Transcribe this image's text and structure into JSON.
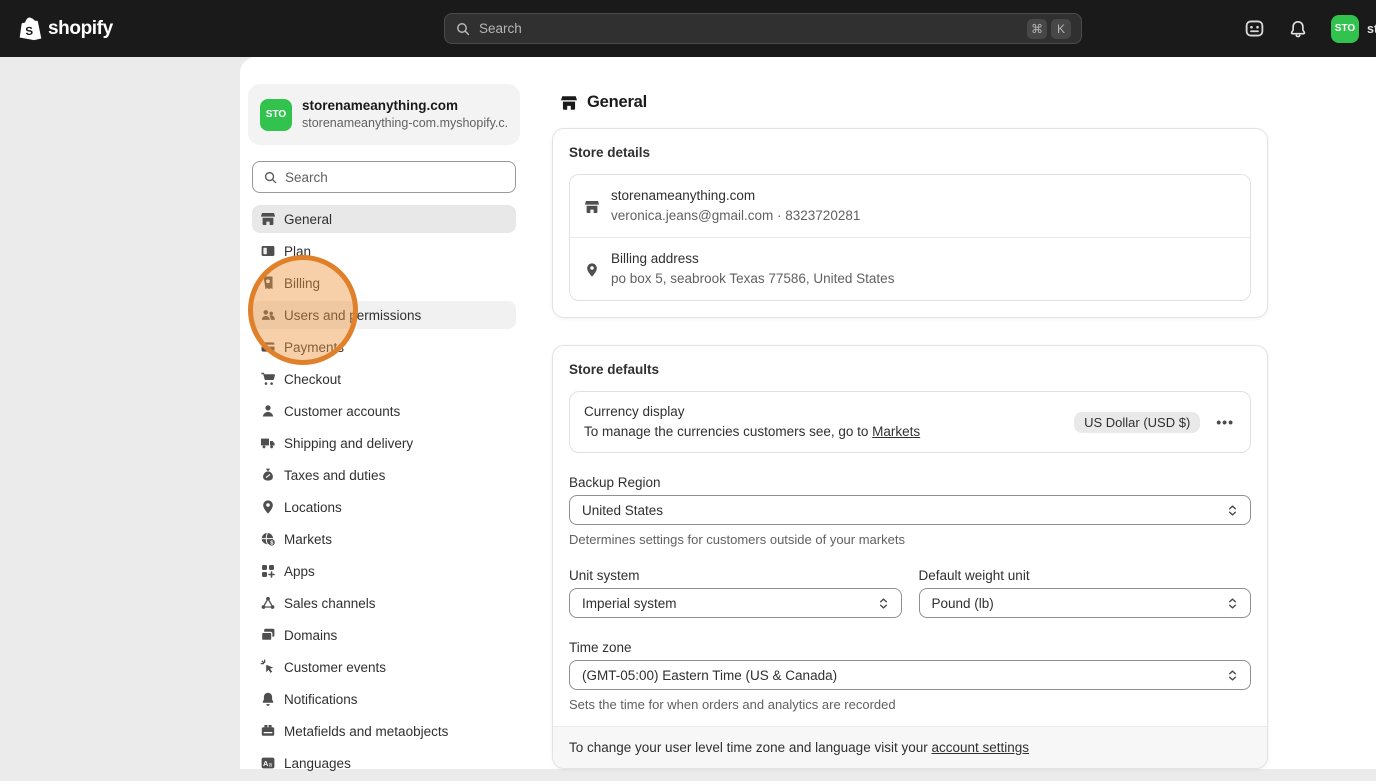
{
  "colors": {
    "topbar_bg": "#1a1a1a",
    "avatar_green": "#32c24e",
    "highlight_orange_border": "#e0802a",
    "highlight_orange_fill": "rgba(238,148,62,0.45)",
    "backdrop": "#ebebeb",
    "text_primary": "#303030",
    "text_secondary": "#616161"
  },
  "topbar": {
    "logo_text": "shopify",
    "search_placeholder": "Search",
    "kbd_cmd": "⌘",
    "kbd_k": "K",
    "avatar_initials": "STO",
    "store_name_truncated": "st"
  },
  "sidebar": {
    "store": {
      "initials": "STO",
      "name": "storenameanything.com",
      "domain": "storenameanything-com.myshopify.c..."
    },
    "search_placeholder": "Search",
    "items": [
      {
        "label": "General",
        "icon": "storefront",
        "state": "active"
      },
      {
        "label": "Plan",
        "icon": "plan",
        "state": ""
      },
      {
        "label": "Billing",
        "icon": "billing",
        "state": ""
      },
      {
        "label": "Users and permissions",
        "icon": "users",
        "state": "hover"
      },
      {
        "label": "Payments",
        "icon": "payments",
        "state": ""
      },
      {
        "label": "Checkout",
        "icon": "cart",
        "state": ""
      },
      {
        "label": "Customer accounts",
        "icon": "person",
        "state": ""
      },
      {
        "label": "Shipping and delivery",
        "icon": "truck",
        "state": ""
      },
      {
        "label": "Taxes and duties",
        "icon": "moneybag",
        "state": ""
      },
      {
        "label": "Locations",
        "icon": "pin",
        "state": ""
      },
      {
        "label": "Markets",
        "icon": "globe",
        "state": ""
      },
      {
        "label": "Apps",
        "icon": "apps",
        "state": ""
      },
      {
        "label": "Sales channels",
        "icon": "nodes",
        "state": ""
      },
      {
        "label": "Domains",
        "icon": "domains",
        "state": ""
      },
      {
        "label": "Customer events",
        "icon": "cursor",
        "state": ""
      },
      {
        "label": "Notifications",
        "icon": "bell",
        "state": ""
      },
      {
        "label": "Metafields and metaobjects",
        "icon": "metafields",
        "state": ""
      },
      {
        "label": "Languages",
        "icon": "languages",
        "state": ""
      }
    ]
  },
  "main": {
    "title": "General",
    "store_details": {
      "heading": "Store details",
      "rows": [
        {
          "icon": "storefront",
          "title": "storenameanything.com",
          "subtitle": "veronica.jeans@gmail.com · 8323720281"
        },
        {
          "icon": "pin",
          "title": "Billing address",
          "subtitle": "po box 5, seabrook Texas 77586, United States"
        }
      ]
    },
    "store_defaults": {
      "heading": "Store defaults",
      "currency": {
        "title": "Currency display",
        "desc_prefix": "To manage the currencies customers see, go to ",
        "link": "Markets",
        "badge": "US Dollar (USD $)"
      },
      "backup_region": {
        "label": "Backup Region",
        "value": "United States",
        "helper": "Determines settings for customers outside of your markets"
      },
      "unit_system": {
        "label": "Unit system",
        "value": "Imperial system"
      },
      "weight_unit": {
        "label": "Default weight unit",
        "value": "Pound (lb)"
      },
      "time_zone": {
        "label": "Time zone",
        "value": "(GMT-05:00) Eastern Time (US & Canada)",
        "helper": "Sets the time for when orders and analytics are recorded"
      },
      "footer": {
        "prefix": "To change your user level time zone and language visit your ",
        "link": "account settings"
      }
    }
  }
}
